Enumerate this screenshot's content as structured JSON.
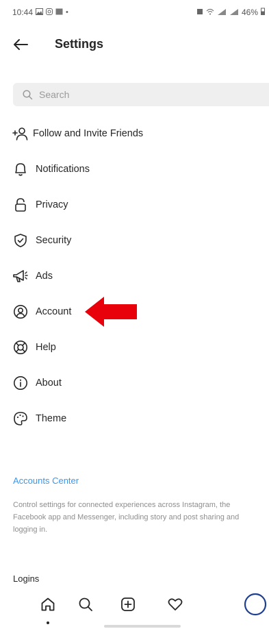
{
  "status_bar": {
    "time": "10:44",
    "left_icons": [
      "gallery-icon",
      "instagram-icon",
      "image-icon",
      "dot"
    ],
    "right_icons": [
      "silent-icon",
      "wifi-icon",
      "signal-icon",
      "signal-icon"
    ],
    "battery": "46%"
  },
  "header": {
    "title": "Settings",
    "back_icon": "arrow-left-icon"
  },
  "search": {
    "placeholder": "Search",
    "value": ""
  },
  "menu": {
    "items": [
      {
        "label": "Follow and Invite Friends",
        "icon": "add-person-icon"
      },
      {
        "label": "Notifications",
        "icon": "bell-icon"
      },
      {
        "label": "Privacy",
        "icon": "lock-icon"
      },
      {
        "label": "Security",
        "icon": "shield-check-icon"
      },
      {
        "label": "Ads",
        "icon": "megaphone-icon"
      },
      {
        "label": "Account",
        "icon": "person-circle-icon"
      },
      {
        "label": "Help",
        "icon": "lifebuoy-icon"
      },
      {
        "label": "About",
        "icon": "info-icon"
      },
      {
        "label": "Theme",
        "icon": "palette-icon"
      }
    ]
  },
  "annotation": {
    "icon": "red-arrow-icon",
    "color": "#e8000b"
  },
  "accounts_center": {
    "title": "Accounts Center",
    "description": "Control settings for connected experiences across Instagram, the Facebook app and Messenger, including story and post sharing and logging in.",
    "link_color": "#3897f0"
  },
  "logins": {
    "label": "Logins"
  },
  "bottom_nav": {
    "items": [
      "home-icon",
      "search-icon",
      "new-post-icon",
      "activity-heart-icon",
      "profile-avatar"
    ]
  }
}
